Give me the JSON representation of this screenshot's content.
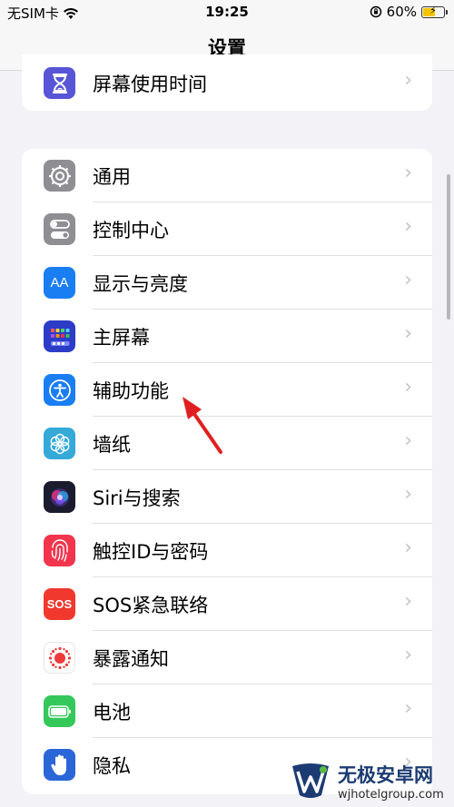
{
  "status_bar": {
    "carrier": "无SIM卡",
    "time": "19:25",
    "battery_percent": "60%",
    "battery_level": 0.6,
    "battery_color": "#f5c400"
  },
  "nav": {
    "title": "设置"
  },
  "top_group": [
    {
      "label": "屏幕使用时间",
      "icon": "hourglass-icon",
      "color": "#5856d6"
    }
  ],
  "main_group": [
    {
      "label": "通用",
      "icon": "gear-icon",
      "color": "#8e8e93"
    },
    {
      "label": "控制中心",
      "icon": "toggles-icon",
      "color": "#8e8e93"
    },
    {
      "label": "显示与亮度",
      "icon": "text-size-icon",
      "icon_text": "AA",
      "color": "#1a7ef3"
    },
    {
      "label": "主屏幕",
      "icon": "home-grid-icon",
      "color": "#2c3cc7"
    },
    {
      "label": "辅助功能",
      "icon": "accessibility-icon",
      "color": "#1a7ef3"
    },
    {
      "label": "墙纸",
      "icon": "flower-icon",
      "color": "#35a9d8"
    },
    {
      "label": "Siri与搜索",
      "icon": "siri-icon",
      "color": "#1b1b2e"
    },
    {
      "label": "触控ID与密码",
      "icon": "fingerprint-icon",
      "color": "#f2354d"
    },
    {
      "label": "SOS紧急联络",
      "icon": "sos-icon",
      "icon_text": "SOS",
      "color": "#f0382f"
    },
    {
      "label": "暴露通知",
      "icon": "exposure-icon",
      "color": "#ffffff"
    },
    {
      "label": "电池",
      "icon": "battery-icon",
      "color": "#34c759"
    },
    {
      "label": "隐私",
      "icon": "hand-icon",
      "color": "#2b66d9"
    }
  ],
  "annotation_color": "#e02020",
  "watermark": {
    "title": "无极安卓网",
    "url": "wjhotelgroup.com"
  }
}
